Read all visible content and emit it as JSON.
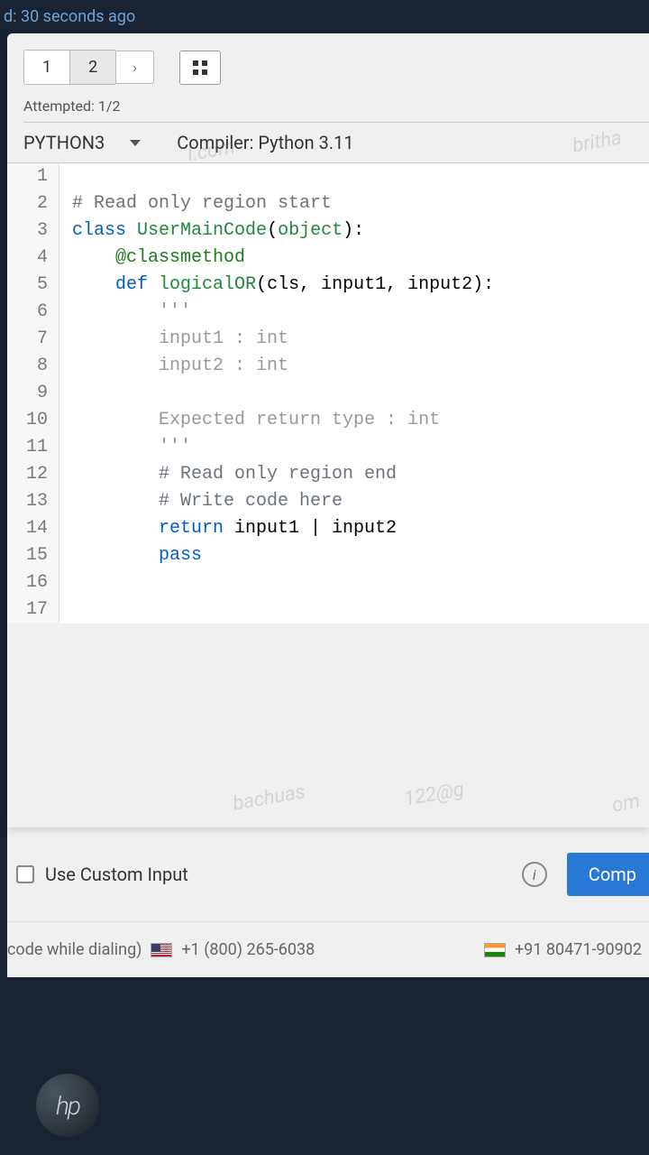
{
  "status": {
    "text": "d: 30 seconds ago"
  },
  "tabs": {
    "items": [
      "1",
      "2"
    ],
    "next_glyph": "›"
  },
  "attempted": {
    "label": "Attempted: 1/2"
  },
  "language": {
    "selected": "PYTHON3"
  },
  "compiler": {
    "label": "Compiler: Python 3.11"
  },
  "code_lines": [
    {
      "n": 1,
      "html": ""
    },
    {
      "n": 2,
      "html": "<span class='c-comment'># Read only region start</span>"
    },
    {
      "n": 3,
      "html": "<span class='c-classkw'>class</span> <span class='c-class'>UserMainCode</span>(<span class='c-obj'>object</span>):"
    },
    {
      "n": 4,
      "html": "    <span class='c-deco'>@classmethod</span>"
    },
    {
      "n": 5,
      "html": "    <span class='c-defkw'>def</span> <span class='c-class'>logicalOR</span>(cls, input1, input2):"
    },
    {
      "n": 6,
      "html": "        <span class='c-str'>'''</span>"
    },
    {
      "n": 7,
      "html": "        <span class='c-str'>input1 : int</span>"
    },
    {
      "n": 8,
      "html": "        <span class='c-str'>input2 : int</span>"
    },
    {
      "n": 9,
      "html": ""
    },
    {
      "n": 10,
      "html": "        <span class='c-str'>Expected return type : int</span>"
    },
    {
      "n": 11,
      "html": "        <span class='c-str'>'''</span>"
    },
    {
      "n": 12,
      "html": "        <span class='c-comment'># Read only region end</span>"
    },
    {
      "n": 13,
      "html": "        <span class='c-comment'># Write code here</span>"
    },
    {
      "n": 14,
      "html": "        <span class='c-ret'>return</span> input1 | input2"
    },
    {
      "n": 15,
      "html": "        <span class='c-ret'>pass</span>"
    },
    {
      "n": 16,
      "html": ""
    },
    {
      "n": 17,
      "html": ""
    }
  ],
  "watermarks": {
    "w1": "l.com",
    "w2": "britha",
    "w3": "bachuas",
    "w4": "122@g",
    "w5": "om"
  },
  "custom_input": {
    "label": "Use Custom Input"
  },
  "info_glyph": "i",
  "compile": {
    "label": "Comp"
  },
  "footer": {
    "dial_text": "code while dialing)",
    "us_number": "+1 (800) 265-6038",
    "in_number": "+91 80471-90902"
  },
  "logo": {
    "text": "hp"
  }
}
